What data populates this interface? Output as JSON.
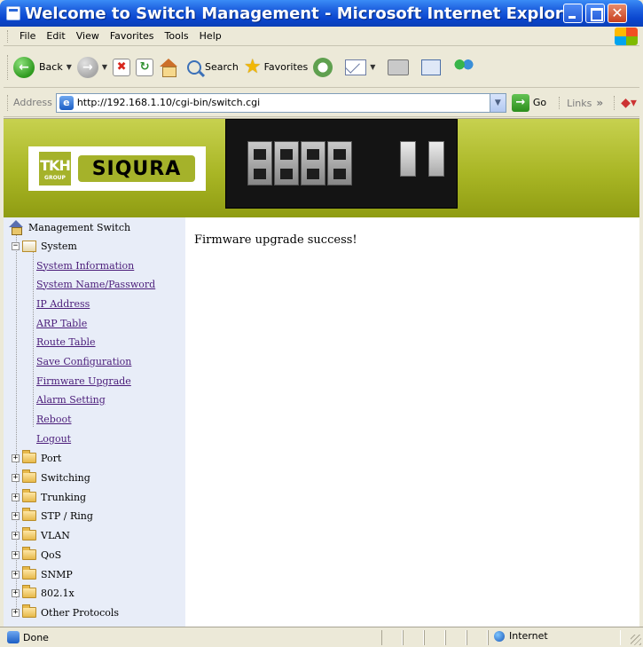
{
  "window": {
    "title": "Welcome to Switch Management - Microsoft Internet Explorer"
  },
  "menu": {
    "items": [
      "File",
      "Edit",
      "View",
      "Favorites",
      "Tools",
      "Help"
    ]
  },
  "toolbar": {
    "back_label": "Back",
    "search_label": "Search",
    "favorites_label": "Favorites"
  },
  "address_bar": {
    "label": "Address",
    "url": "http://192.168.1.10/cgi-bin/switch.cgi",
    "go_label": "Go",
    "links_label": "Links"
  },
  "banner": {
    "logo_tkh": "TKH",
    "logo_group": "GROUP",
    "logo_brand": "SIQURA"
  },
  "sidebar": {
    "root": "Management Switch",
    "system": {
      "label": "System",
      "children": [
        "System Information",
        "System Name/Password",
        "IP Address",
        "ARP Table",
        "Route Table",
        "Save Configuration",
        "Firmware Upgrade",
        "Alarm Setting",
        "Reboot",
        "Logout"
      ]
    },
    "folders": [
      "Port",
      "Switching",
      "Trunking",
      "STP / Ring",
      "VLAN",
      "QoS",
      "SNMP",
      "802.1x",
      "Other Protocols"
    ]
  },
  "main": {
    "message": "Firmware upgrade success!"
  },
  "statusbar": {
    "status": "Done",
    "zone": "Internet"
  },
  "icons": {
    "back": "back-arrow-icon",
    "forward": "forward-arrow-icon",
    "stop": "stop-icon",
    "refresh": "refresh-icon",
    "home": "home-icon",
    "search": "search-icon",
    "favorites": "star-icon",
    "history": "history-icon",
    "mail": "mail-icon",
    "print": "print-icon",
    "edit": "edit-icon",
    "messenger": "messenger-icon",
    "folder": "folder-icon",
    "globe": "globe-icon"
  },
  "colors": {
    "titlebar": "#0a46cf",
    "banner": "#a9b625",
    "sidebar_bg": "#e8edf8",
    "link": "#4b1d7a"
  }
}
